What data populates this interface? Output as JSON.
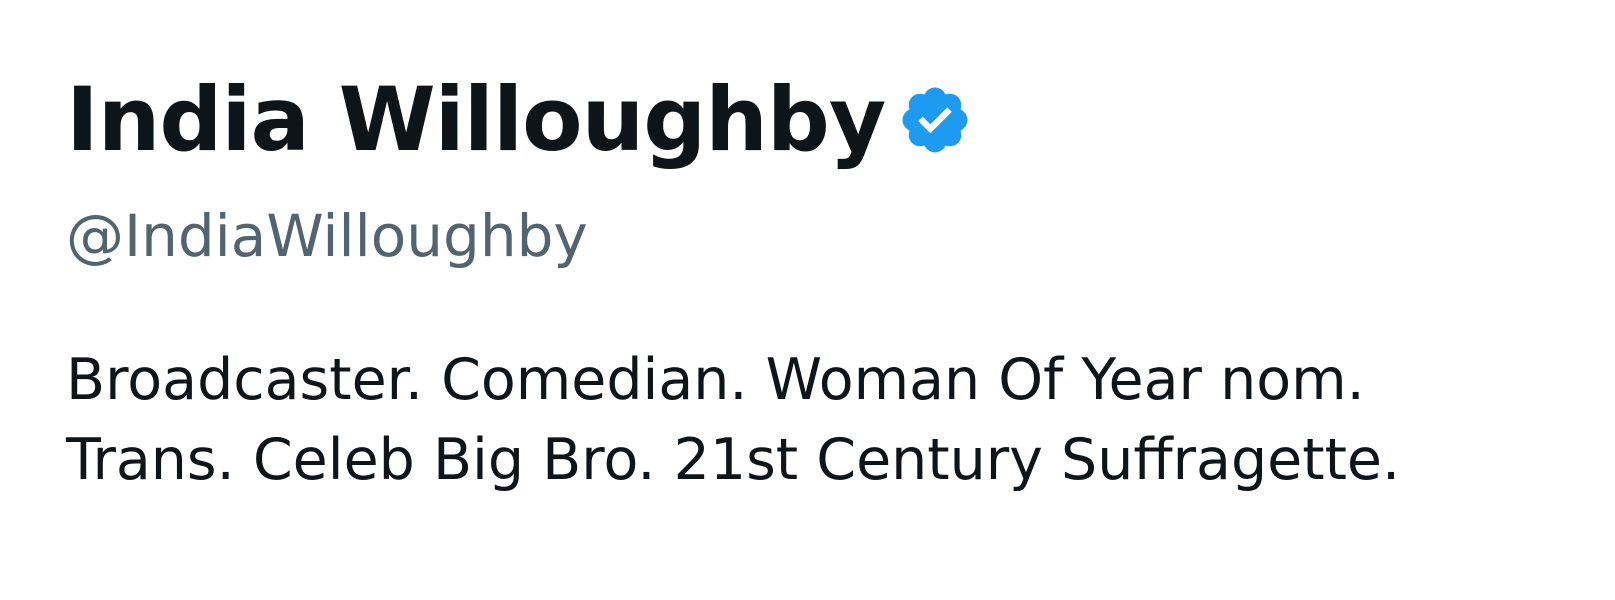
{
  "profile": {
    "display_name": "India Willoughby",
    "verified_icon": "verified-badge-icon",
    "handle": "@IndiaWilloughby",
    "bio_lines": [
      "Broadcaster. Comedian. Woman Of Year nom.",
      "Trans. Celeb Big Bro. 21st Century Suffragette."
    ]
  },
  "colors": {
    "name": "#0f1419",
    "handle": "#536471",
    "verified": "#1d9bf0"
  }
}
